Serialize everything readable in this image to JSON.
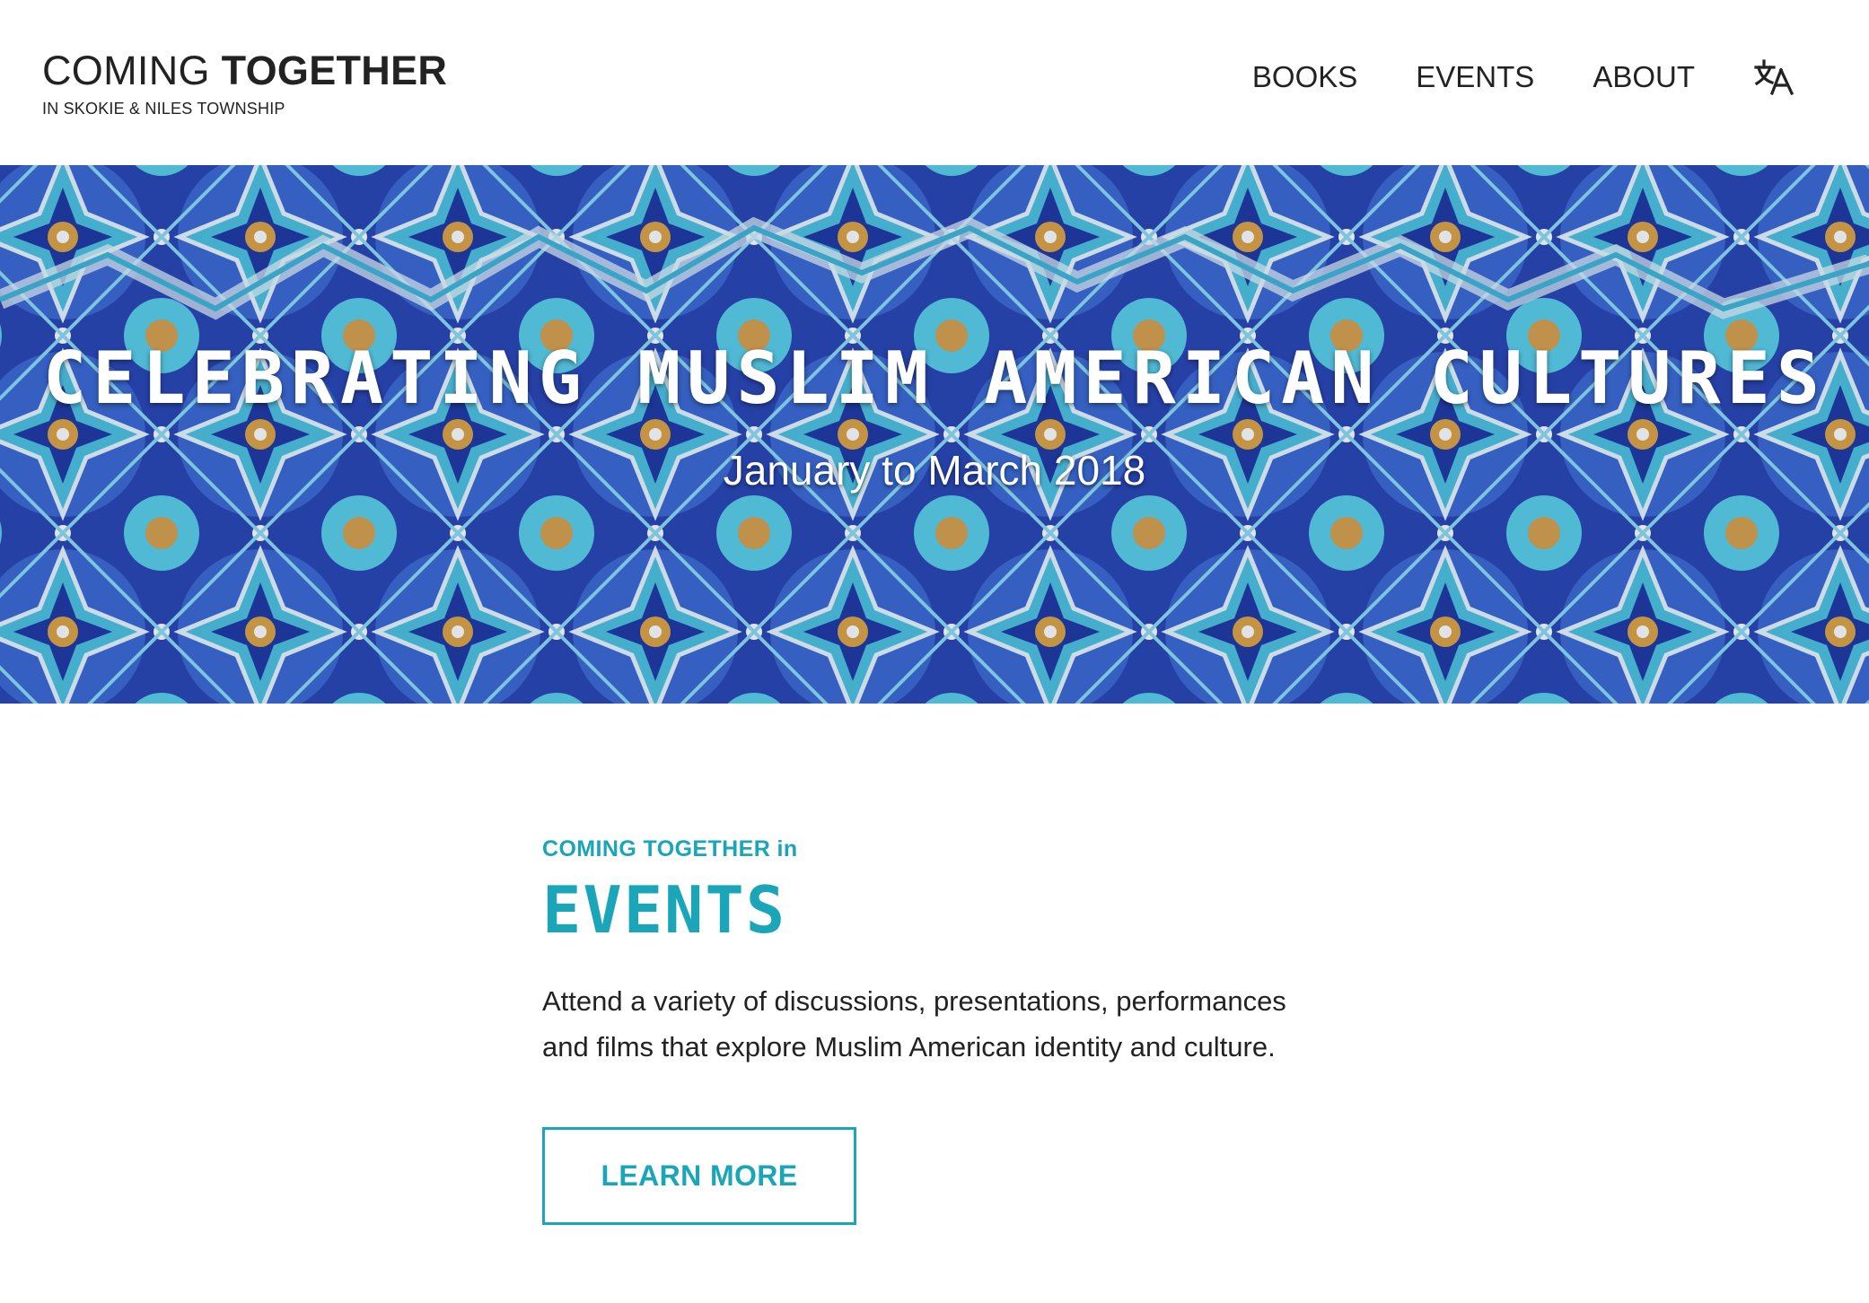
{
  "header": {
    "brand_light": "COMING",
    "brand_bold": "TOGETHER",
    "brand_sub": "IN SKOKIE & NILES TOWNSHIP",
    "nav": [
      {
        "label": "BOOKS"
      },
      {
        "label": "EVENTS"
      },
      {
        "label": "ABOUT"
      }
    ],
    "translate_icon": "translate-icon"
  },
  "hero": {
    "title": "CELEBRATING MUSLIM AMERICAN CULTURES",
    "subtitle": "January to March 2018",
    "background": "blue-tile-mosaic-image"
  },
  "feature": {
    "eyebrow": "COMING TOGETHER in",
    "title": "EVENTS",
    "description": "Attend a variety of discussions, presentations, performances and films that explore Muslim American identity and culture.",
    "button_label": "LEARN MORE"
  },
  "colors": {
    "accent": "#1aa5b8",
    "text": "#222222",
    "background": "#ffffff"
  }
}
